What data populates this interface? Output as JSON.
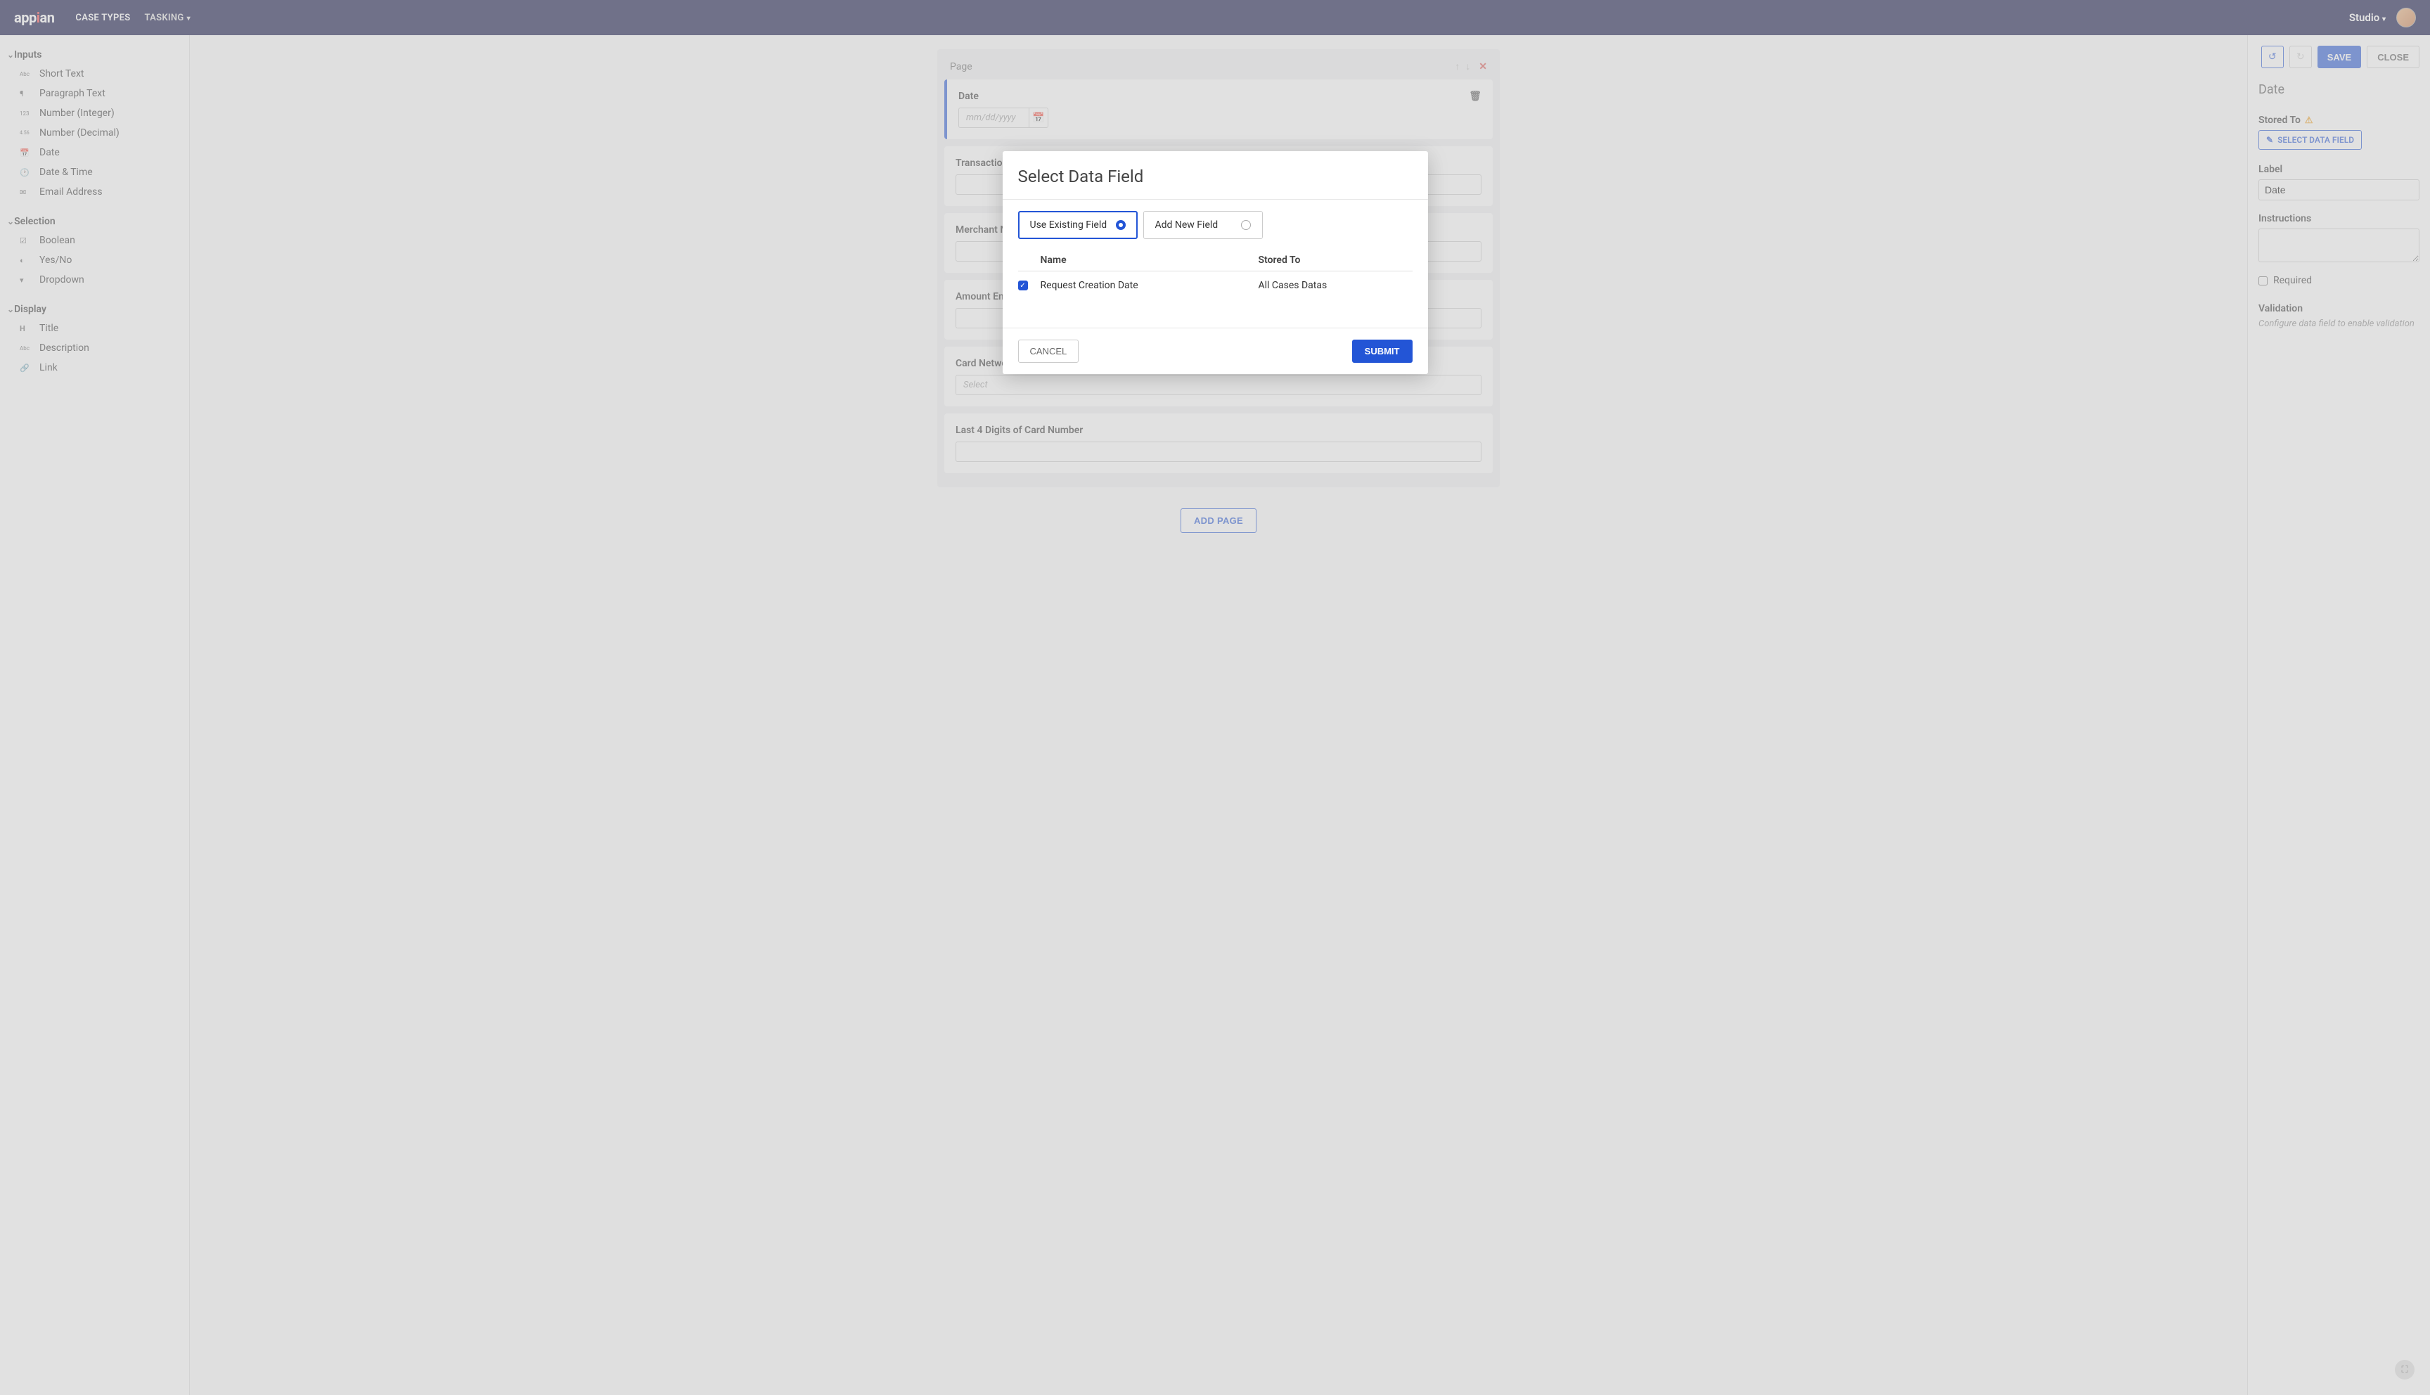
{
  "topbar": {
    "logo": "appian",
    "tabs": [
      {
        "label": "CASE TYPES",
        "active": true
      },
      {
        "label": "TASKING",
        "dropdown": true
      }
    ],
    "studio_label": "Studio"
  },
  "sidebar": {
    "groups": [
      {
        "title": "Inputs",
        "items": [
          {
            "icon": "Abc",
            "label": "Short Text"
          },
          {
            "icon": "¶",
            "label": "Paragraph Text"
          },
          {
            "icon": "123",
            "label": "Number (Integer)"
          },
          {
            "icon": "4.56",
            "label": "Number (Decimal)"
          },
          {
            "icon": "📅",
            "label": "Date"
          },
          {
            "icon": "🕑",
            "label": "Date & Time"
          },
          {
            "icon": "✉",
            "label": "Email Address"
          }
        ]
      },
      {
        "title": "Selection",
        "items": [
          {
            "icon": "☑",
            "label": "Boolean"
          },
          {
            "icon": "◐",
            "label": "Yes/No"
          },
          {
            "icon": "▾",
            "label": "Dropdown"
          }
        ]
      },
      {
        "title": "Display",
        "items": [
          {
            "icon": "H",
            "label": "Title"
          },
          {
            "icon": "Abc",
            "label": "Description"
          },
          {
            "icon": "🔗",
            "label": "Link"
          }
        ]
      }
    ]
  },
  "page": {
    "header": "Page",
    "fields": [
      {
        "label": "Date",
        "type": "date",
        "placeholder": "mm/dd/yyyy",
        "selected": true,
        "trash": true
      },
      {
        "label": "Transaction Date",
        "type": "text"
      },
      {
        "label": "Merchant Name",
        "type": "text"
      },
      {
        "label": "Amount Entered",
        "type": "text"
      },
      {
        "label": "Card Network",
        "type": "select",
        "placeholder": "Select"
      },
      {
        "label": "Last 4 Digits of Card Number",
        "type": "text"
      }
    ],
    "add_page_label": "ADD PAGE"
  },
  "rightpanel": {
    "actions": {
      "save": "SAVE",
      "close": "CLOSE"
    },
    "title": "Date",
    "stored_to_label": "Stored To",
    "select_df": "SELECT DATA FIELD",
    "label_label": "Label",
    "label_value": "Date",
    "instructions_label": "Instructions",
    "required_label": "Required",
    "validation_label": "Validation",
    "validation_hint": "Configure data field to enable validation"
  },
  "modal": {
    "title": "Select Data Field",
    "option_existing": "Use Existing Field",
    "option_new": "Add New Field",
    "columns": {
      "name": "Name",
      "stored_to": "Stored To"
    },
    "rows": [
      {
        "name": "Request Creation Date",
        "stored_to": "All Cases Datas",
        "checked": true
      }
    ],
    "cancel": "CANCEL",
    "submit": "SUBMIT"
  }
}
